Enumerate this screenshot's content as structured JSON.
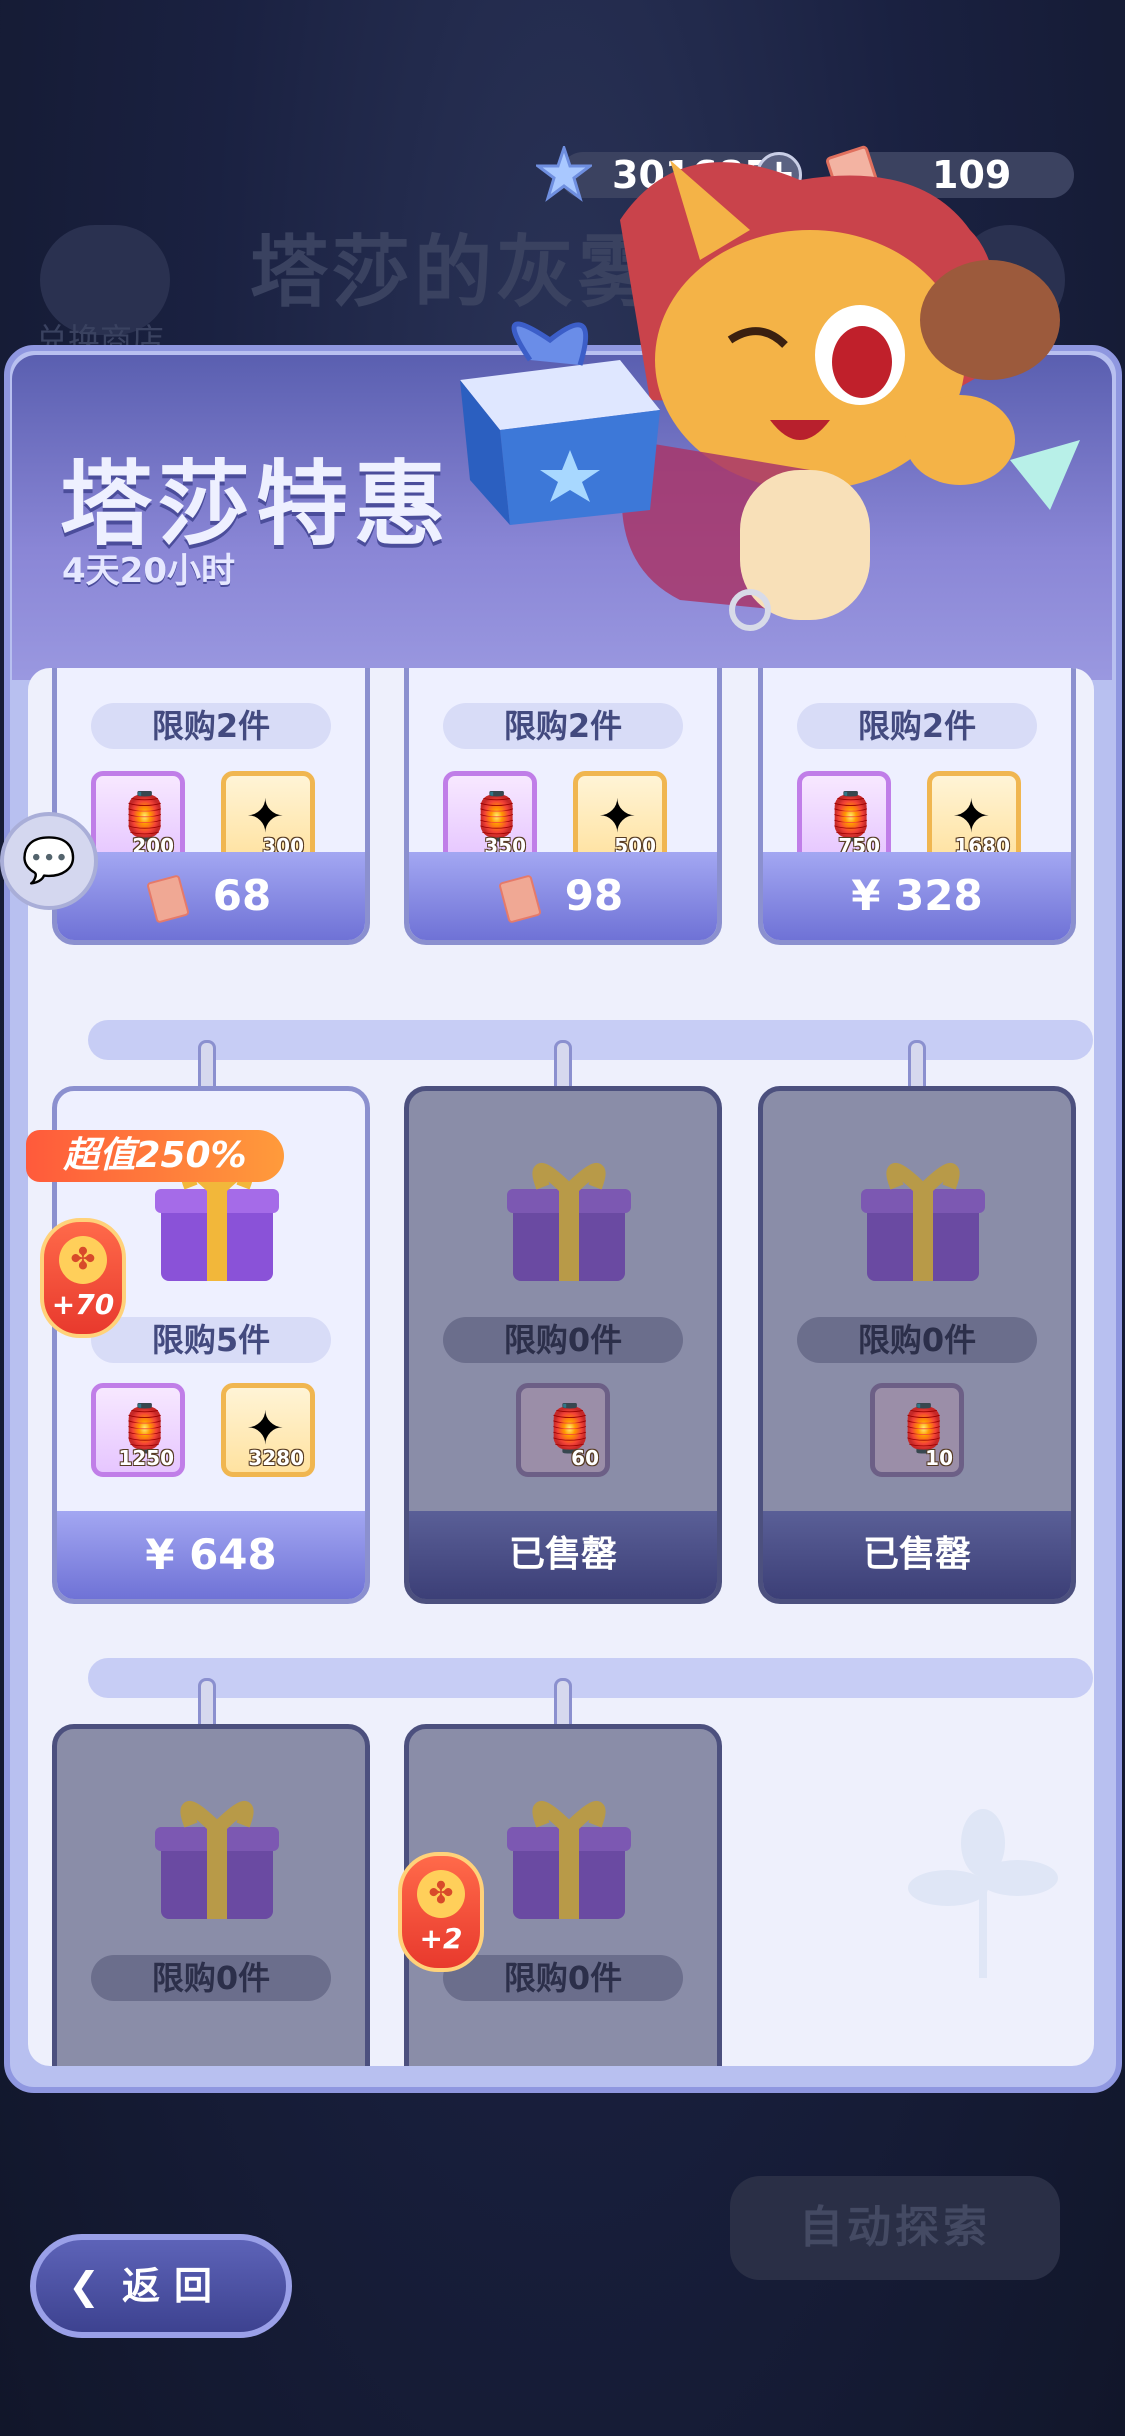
{
  "currency": {
    "star_amount": "301685",
    "ticket_amount": "109",
    "star_icon": "star-crystal-icon",
    "ticket_icon": "ticket-icon"
  },
  "background": {
    "shop_label": "兑换商店",
    "event_title": "塔莎的灰雾"
  },
  "banner": {
    "title": "塔莎特惠",
    "timer": "4天20小时"
  },
  "colors": {
    "panel": "#b8c0f0",
    "price_button": "#6f72d6",
    "sold_button": "#3c3f77",
    "badge": "#ff5a3b"
  },
  "cards": [
    {
      "limit": "限购2件",
      "items": [
        {
          "icon": "lantern-icon",
          "qty": "200"
        },
        {
          "icon": "star-crystal-icon",
          "qty": "300"
        }
      ],
      "price": "68",
      "price_type": "ticket"
    },
    {
      "limit": "限购2件",
      "items": [
        {
          "icon": "lantern-icon",
          "qty": "350"
        },
        {
          "icon": "star-crystal-icon",
          "qty": "500"
        }
      ],
      "price": "98",
      "price_type": "ticket"
    },
    {
      "limit": "限购2件",
      "items": [
        {
          "icon": "lantern-icon",
          "qty": "750"
        },
        {
          "icon": "star-crystal-icon",
          "qty": "1680"
        }
      ],
      "price": "¥ 328",
      "price_type": "cash"
    },
    {
      "limit": "限购5件",
      "badge": "超值250%",
      "coin": "+70",
      "items": [
        {
          "icon": "lantern-icon",
          "qty": "1250"
        },
        {
          "icon": "star-crystal-icon",
          "qty": "3280"
        }
      ],
      "price": "¥ 648",
      "price_type": "cash"
    },
    {
      "limit": "限购0件",
      "items": [
        {
          "icon": "lantern-icon",
          "qty": "60"
        }
      ],
      "price": "已售罄",
      "price_type": "sold"
    },
    {
      "limit": "限购0件",
      "items": [
        {
          "icon": "lantern-icon",
          "qty": "10"
        }
      ],
      "price": "已售罄",
      "price_type": "sold"
    },
    {
      "limit": "限购0件",
      "price_type": "sold"
    },
    {
      "limit": "限购0件",
      "coin": "+2",
      "price_type": "sold"
    }
  ],
  "buttons": {
    "back": "返回",
    "auto_explore": "自动探索"
  }
}
